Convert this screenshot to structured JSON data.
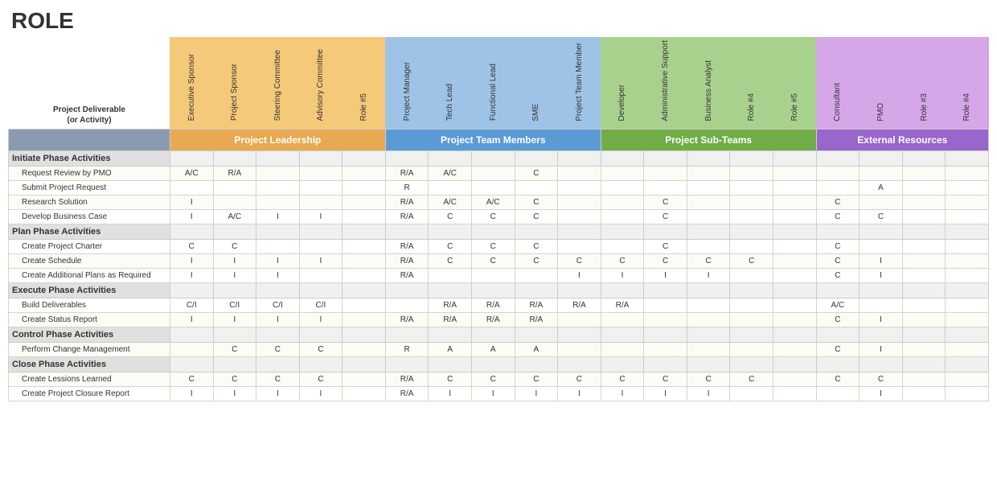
{
  "title": "ROLE",
  "label_header": {
    "line1": "Project Deliverable",
    "line2": "(or Activity)"
  },
  "column_groups": [
    {
      "id": "leadership",
      "label": "Project Leadership",
      "color": "#e8a951",
      "header_color": "#f5c97a",
      "columns": [
        "Executive Sponsor",
        "Project Sponsor",
        "Steering Committee",
        "Advisory Committee",
        "Role #5"
      ]
    },
    {
      "id": "team",
      "label": "Project Team Members",
      "color": "#5b9bd5",
      "header_color": "#9dc3e6",
      "columns": [
        "Project Manager",
        "Tech Lead",
        "Functional Lead",
        "SME",
        "Project Team Member"
      ]
    },
    {
      "id": "subteams",
      "label": "Project Sub-Teams",
      "color": "#70ad47",
      "header_color": "#a9d18e",
      "columns": [
        "Developer",
        "Administrative Support",
        "Business Analyst",
        "Role #4",
        "Role #5"
      ]
    },
    {
      "id": "external",
      "label": "External Resources",
      "color": "#9966cc",
      "header_color": "#d5a6e8",
      "columns": [
        "Consultant",
        "PMO",
        "Role #3",
        "Role #4"
      ]
    }
  ],
  "rows": [
    {
      "type": "phase",
      "label": "Initiate Phase Activities",
      "cells": [
        "",
        "",
        "",
        "",
        "",
        "",
        "",
        "",
        "",
        "",
        "",
        "",
        "",
        "",
        "",
        "",
        "",
        "",
        ""
      ]
    },
    {
      "type": "activity",
      "label": "Request Review by PMO",
      "cells": [
        "A/C",
        "R/A",
        "",
        "",
        "",
        "R/A",
        "A/C",
        "",
        "C",
        "",
        "",
        "",
        "",
        "",
        "",
        "",
        "",
        "",
        ""
      ]
    },
    {
      "type": "activity",
      "label": "Submit Project Request",
      "cells": [
        "",
        "",
        "",
        "",
        "",
        "R",
        "",
        "",
        "",
        "",
        "",
        "",
        "",
        "",
        "",
        "",
        "A",
        "",
        ""
      ]
    },
    {
      "type": "activity",
      "label": "Research Solution",
      "cells": [
        "I",
        "",
        "",
        "",
        "",
        "R/A",
        "A/C",
        "A/C",
        "C",
        "",
        "",
        "C",
        "",
        "",
        "",
        "C",
        "",
        "",
        ""
      ]
    },
    {
      "type": "activity",
      "label": "Develop Business Case",
      "cells": [
        "I",
        "A/C",
        "I",
        "I",
        "",
        "R/A",
        "C",
        "C",
        "C",
        "",
        "",
        "C",
        "",
        "",
        "",
        "C",
        "C",
        "",
        ""
      ]
    },
    {
      "type": "phase",
      "label": "Plan Phase Activities",
      "cells": [
        "",
        "",
        "",
        "",
        "",
        "",
        "",
        "",
        "",
        "",
        "",
        "",
        "",
        "",
        "",
        "",
        "",
        "",
        ""
      ]
    },
    {
      "type": "activity",
      "label": "Create Project Charter",
      "cells": [
        "C",
        "C",
        "",
        "",
        "",
        "R/A",
        "C",
        "C",
        "C",
        "",
        "",
        "C",
        "",
        "",
        "",
        "C",
        "",
        "",
        ""
      ]
    },
    {
      "type": "activity",
      "label": "Create Schedule",
      "cells": [
        "I",
        "I",
        "I",
        "I",
        "",
        "R/A",
        "C",
        "C",
        "C",
        "C",
        "C",
        "C",
        "C",
        "C",
        "",
        "C",
        "I",
        "",
        ""
      ]
    },
    {
      "type": "activity",
      "label": "Create Additional Plans as Required",
      "cells": [
        "I",
        "I",
        "I",
        "",
        "",
        "R/A",
        "",
        "",
        "",
        "I",
        "I",
        "I",
        "I",
        "",
        "",
        "C",
        "I",
        "",
        ""
      ]
    },
    {
      "type": "phase",
      "label": "Execute Phase Activities",
      "cells": [
        "",
        "",
        "",
        "",
        "",
        "",
        "",
        "",
        "",
        "",
        "",
        "",
        "",
        "",
        "",
        "",
        "",
        "",
        ""
      ]
    },
    {
      "type": "activity",
      "label": "Build Deliverables",
      "cells": [
        "C/I",
        "C/I",
        "C/I",
        "C/I",
        "",
        "",
        "R/A",
        "R/A",
        "R/A",
        "R/A",
        "R/A",
        "",
        "",
        "",
        "",
        "A/C",
        "",
        "",
        ""
      ]
    },
    {
      "type": "activity",
      "label": "Create Status Report",
      "cells": [
        "I",
        "I",
        "I",
        "I",
        "",
        "R/A",
        "R/A",
        "R/A",
        "R/A",
        "",
        "",
        "",
        "",
        "",
        "",
        "C",
        "I",
        "",
        ""
      ]
    },
    {
      "type": "phase",
      "label": "Control Phase Activities",
      "cells": [
        "",
        "",
        "",
        "",
        "",
        "",
        "",
        "",
        "",
        "",
        "",
        "",
        "",
        "",
        "",
        "",
        "",
        "",
        ""
      ]
    },
    {
      "type": "activity",
      "label": "Perform Change Management",
      "cells": [
        "",
        "C",
        "C",
        "C",
        "",
        "R",
        "A",
        "A",
        "A",
        "",
        "",
        "",
        "",
        "",
        "",
        "C",
        "I",
        "",
        ""
      ]
    },
    {
      "type": "phase",
      "label": "Close Phase Activities",
      "cells": [
        "",
        "",
        "",
        "",
        "",
        "",
        "",
        "",
        "",
        "",
        "",
        "",
        "",
        "",
        "",
        "",
        "",
        "",
        ""
      ]
    },
    {
      "type": "activity",
      "label": "Create Lessions Learned",
      "cells": [
        "C",
        "C",
        "C",
        "C",
        "",
        "R/A",
        "C",
        "C",
        "C",
        "C",
        "C",
        "C",
        "C",
        "C",
        "",
        "C",
        "C",
        "",
        ""
      ]
    },
    {
      "type": "activity",
      "label": "Create Project Closure Report",
      "cells": [
        "I",
        "I",
        "I",
        "I",
        "",
        "R/A",
        "I",
        "I",
        "I",
        "I",
        "I",
        "I",
        "I",
        "",
        "",
        "",
        "I",
        "",
        ""
      ]
    }
  ]
}
